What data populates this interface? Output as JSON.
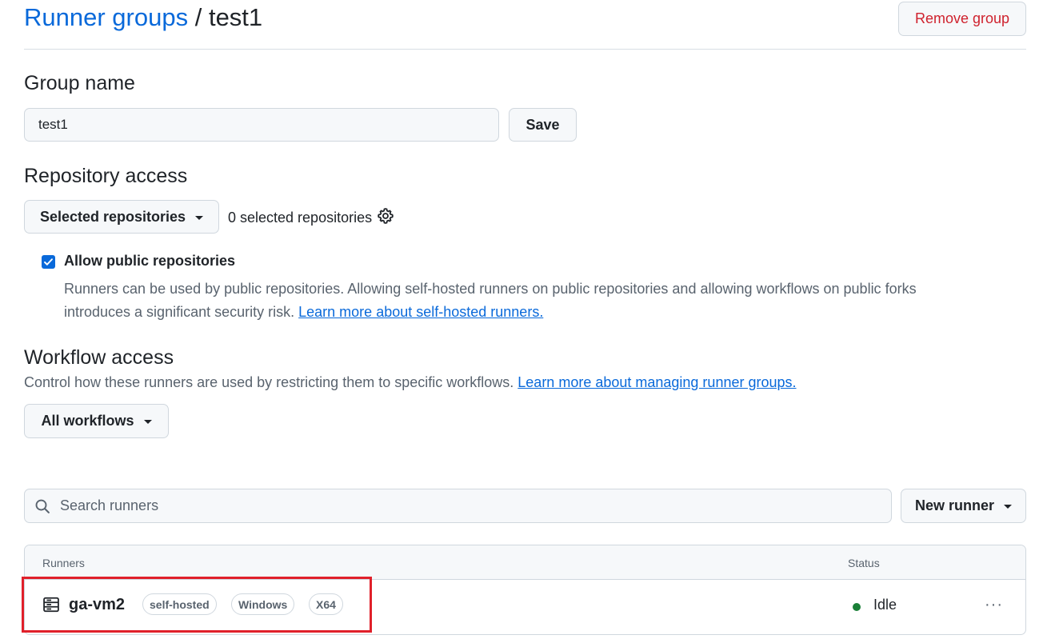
{
  "header": {
    "breadcrumb_link": "Runner groups",
    "breadcrumb_separator": "/",
    "breadcrumb_current": "test1",
    "remove_button": "Remove group"
  },
  "group_name": {
    "heading": "Group name",
    "value": "test1",
    "save_button": "Save"
  },
  "repository_access": {
    "heading": "Repository access",
    "dropdown_label": "Selected repositories",
    "selected_count": "0 selected repositories",
    "allow_public_label": "Allow public repositories",
    "allow_public_checked": true,
    "description": "Runners can be used by public repositories. Allowing self-hosted runners on public repositories and allowing workflows on public forks introduces a significant security risk.",
    "learn_more_link": "Learn more about self-hosted runners."
  },
  "workflow_access": {
    "heading": "Workflow access",
    "description": "Control how these runners are used by restricting them to specific workflows.",
    "learn_more_link": "Learn more about managing runner groups.",
    "dropdown_label": "All workflows"
  },
  "runners": {
    "search_placeholder": "Search runners",
    "new_runner_button": "New runner",
    "columns": [
      "Runners",
      "Status"
    ],
    "rows": [
      {
        "name": "ga-vm2",
        "labels": [
          "self-hosted",
          "Windows",
          "X64"
        ],
        "status": "Idle",
        "more": "···"
      }
    ]
  },
  "colors": {
    "link": "#0969da",
    "danger": "#cf222e",
    "status_idle": "#1a7f37",
    "highlight": "#e0202a"
  }
}
